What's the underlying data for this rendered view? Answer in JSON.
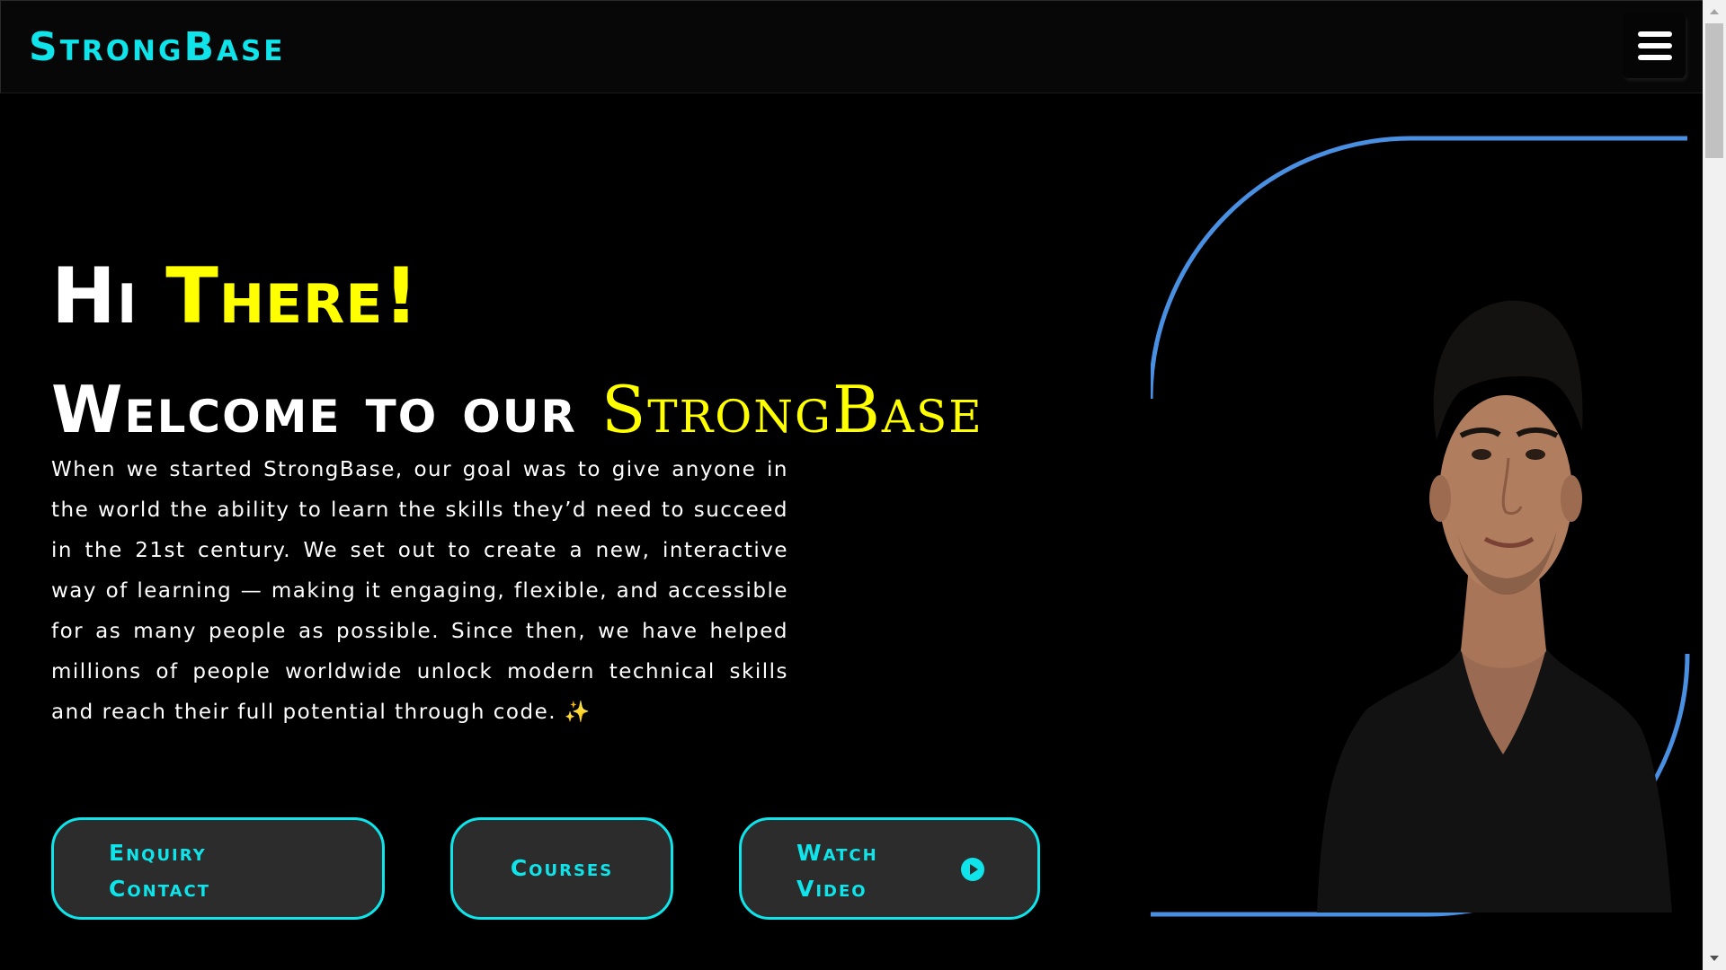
{
  "nav": {
    "brand": "StrongBase",
    "menu_icon": "hamburger-menu-icon"
  },
  "hero": {
    "greeting_prefix": "Hi",
    "greeting_highlight": "There!",
    "welcome_prefix": "Welcome to our",
    "welcome_highlight": "StrongBase",
    "intro": "When we started StrongBase, our goal was to give anyone in the world the ability to learn the skills they’d need to succeed in the 21st century. We set out to create a new, interactive way of learning — making it engaging, flexible, and accessible for as many people as possible. Since then, we have helped millions of people worldwide unlock modern technical skills and reach their full potential through code. ✨"
  },
  "buttons": {
    "enquiry": "Enquiry Contact",
    "courses": "Courses",
    "watch_video": "Watch Video",
    "play_icon": "play-circle-icon"
  },
  "colors": {
    "accent_cyan": "#0ee4ea",
    "highlight_yellow": "#ffff00",
    "frame_blue": "#4a90e2",
    "button_bg": "#2c2c2c",
    "background": "#000000"
  }
}
